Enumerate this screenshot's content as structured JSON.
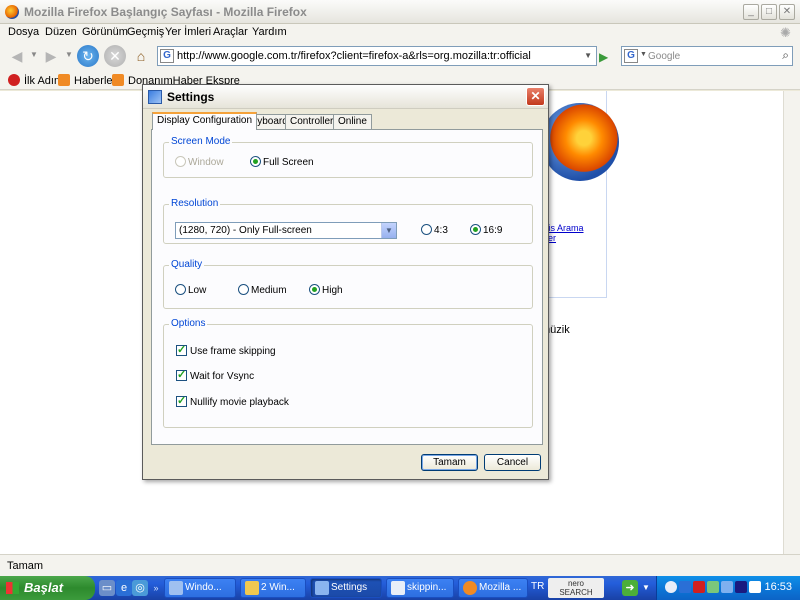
{
  "firefox": {
    "title": "Mozilla Firefox Başlangıç Sayfası - Mozilla Firefox",
    "menu": [
      "Dosya",
      "Düzen",
      "Görünüm",
      "Geçmiş",
      "Yer İmleri",
      "Araçlar",
      "Yardım"
    ],
    "url": "http://www.google.com.tr/firefox?client=firefox-a&rls=org.mozilla:tr:official",
    "search_placeholder": "Google",
    "bookmarks": [
      "İlk Adım",
      "Haberler",
      "DonanımHaber Ekspre"
    ],
    "content": {
      "link1": "mis Arama",
      "link2": "hler",
      "text_muzik": "müzik"
    },
    "status": "Tamam"
  },
  "dialog": {
    "title": "Settings",
    "tabs": [
      "Display Configuration",
      "Keyboard",
      "Controller",
      "Online"
    ],
    "active_tab": 0,
    "screen_mode": {
      "legend": "Screen Mode",
      "window": "Window",
      "full_screen": "Full Screen",
      "selected": "Full Screen"
    },
    "resolution": {
      "legend": "Resolution",
      "value": "(1280, 720) - Only Full-screen",
      "aspect_4_3": "4:3",
      "aspect_16_9": "16:9",
      "selected_aspect": "16:9"
    },
    "quality": {
      "legend": "Quality",
      "low": "Low",
      "medium": "Medium",
      "high": "High",
      "selected": "High"
    },
    "options": {
      "legend": "Options",
      "frame_skipping": "Use frame skipping",
      "vsync": "Wait for Vsync",
      "nullify_movie": "Nullify movie playback",
      "frame_skipping_checked": true,
      "vsync_checked": true,
      "nullify_movie_checked": true
    },
    "ok_button": "Tamam",
    "cancel_button": "Cancel"
  },
  "taskbar": {
    "start": "Başlat",
    "tasks": [
      "Windo...",
      "2 Win...",
      "Settings",
      "skippin...",
      "Mozilla ..."
    ],
    "active_task": "Settings",
    "language": "TR",
    "nero": "nero",
    "nero_sub": "SEARCH",
    "clock": "16:53"
  },
  "colors": {
    "xp_blue": "#245edb",
    "start_green": "#3c9b3c",
    "dialog_bg": "#ece9d8",
    "legend_blue": "#0046d5",
    "check_green": "#21a121"
  }
}
